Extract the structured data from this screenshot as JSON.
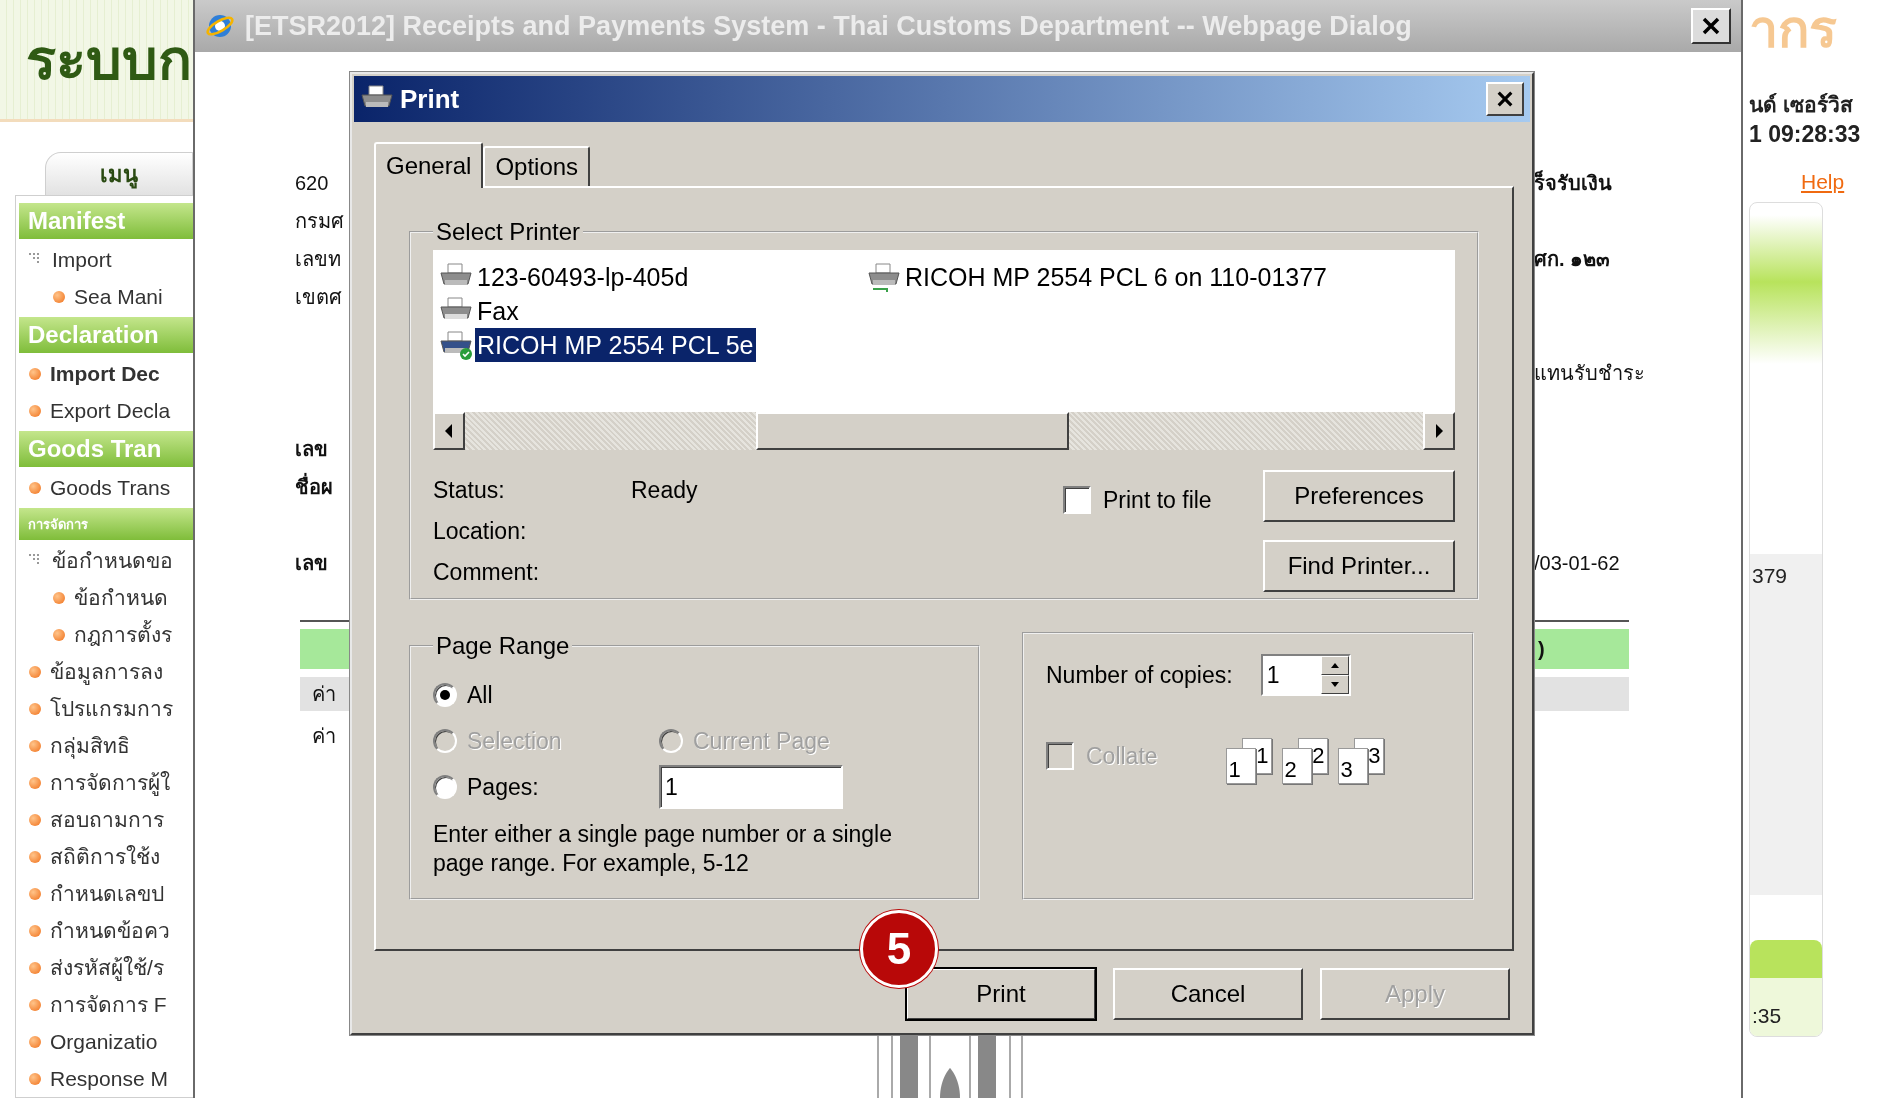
{
  "background_page": {
    "logo_text": "ระบบก",
    "menu_tab": "เมนู",
    "sidebar": [
      {
        "kind": "header",
        "label": "Manifest"
      },
      {
        "kind": "folder",
        "label": "Import",
        "children": [
          {
            "kind": "item",
            "label": "Sea Mani",
            "active": false
          }
        ]
      },
      {
        "kind": "header",
        "label": "Declaration"
      },
      {
        "kind": "item",
        "label": "Import Dec",
        "active": true
      },
      {
        "kind": "item",
        "label": "Export Decla",
        "active": false
      },
      {
        "kind": "header",
        "label": "Goods Tran"
      },
      {
        "kind": "item",
        "label": "Goods Trans",
        "active": false
      },
      {
        "kind": "subheader",
        "label": "การจัดการ"
      },
      {
        "kind": "folder",
        "label": "ข้อกำหนดขอ",
        "children": [
          {
            "kind": "item",
            "label": "ข้อกำหนด",
            "active": false
          },
          {
            "kind": "item",
            "label": "กฎการตั้งร",
            "active": false
          }
        ]
      },
      {
        "kind": "item",
        "label": "ข้อมูลการลง",
        "active": false
      },
      {
        "kind": "item",
        "label": "โปรแกรมการ",
        "active": false
      },
      {
        "kind": "item",
        "label": "กลุ่มสิทธิ",
        "active": false
      },
      {
        "kind": "item",
        "label": "การจัดการผู้ใ",
        "active": false
      },
      {
        "kind": "item",
        "label": "สอบถามการ",
        "active": false
      },
      {
        "kind": "item",
        "label": "สถิติการใช้ง",
        "active": false
      },
      {
        "kind": "item",
        "label": "กำหนดเลขป",
        "active": false
      },
      {
        "kind": "item",
        "label": "กำหนดข้อคว",
        "active": false
      },
      {
        "kind": "item",
        "label": "ส่งรหัสผู้ใช้/ร",
        "active": false
      },
      {
        "kind": "item",
        "label": "การจัดการ F",
        "active": false
      },
      {
        "kind": "item",
        "label": "Organizatio",
        "active": false
      },
      {
        "kind": "item",
        "label": "Response M",
        "active": false
      }
    ],
    "header_right": {
      "logo_text": "ากร",
      "user": "นด์ เซอร์วิส",
      "datetime": "1 09:28:33",
      "help": "Help"
    },
    "panel_values": [
      "379",
      ":35"
    ]
  },
  "webpage_dialog": {
    "title": "[ETSR2012] Receipts and Payments System - Thai Customs Department -- Webpage Dialog",
    "rows": [
      {
        "kind": "text",
        "left": {
          "text": "620",
          "bold": false
        },
        "right": {
          "text": "ร็จรับเงิน",
          "bold": true
        }
      },
      {
        "kind": "text",
        "left": {
          "text": "กรมศ",
          "bold": false
        }
      },
      {
        "kind": "text",
        "left": {
          "text": "เลขท",
          "bold": false
        },
        "right": {
          "text": "ศก. ๑๒๓",
          "bold": true
        }
      },
      {
        "kind": "text",
        "left": {
          "text": "เขตศ",
          "bold": false
        }
      },
      {
        "kind": "blank"
      },
      {
        "kind": "text",
        "right": {
          "text": "แทนรับชำระ",
          "bold": false
        }
      },
      {
        "kind": "blank"
      },
      {
        "kind": "text",
        "left": {
          "text": "เลข",
          "bold": true
        }
      },
      {
        "kind": "text",
        "left": {
          "text": "ชื่อผ",
          "bold": true
        }
      },
      {
        "kind": "blank"
      },
      {
        "kind": "text",
        "left": {
          "text": "เลข",
          "bold": true
        },
        "right": {
          "text": "/03-01-62",
          "bold": false
        }
      }
    ],
    "table": {
      "header_right": ")",
      "rows": [
        {
          "left": "ค่า",
          "shaded": true
        },
        {
          "left": "ค่า",
          "shaded": false
        }
      ]
    }
  },
  "print_dialog": {
    "title": "Print",
    "tabs": [
      {
        "label": "General",
        "selected": true
      },
      {
        "label": "Options",
        "selected": false
      }
    ],
    "select_printer": {
      "legend": "Select Printer",
      "printers": [
        {
          "name": "123-60493-lp-405d",
          "kind": "printer",
          "selected": false
        },
        {
          "name": "Fax",
          "kind": "fax",
          "selected": false
        },
        {
          "name": "RICOH MP 2554 PCL 5e",
          "kind": "default",
          "selected": true
        },
        {
          "name": "RICOH MP 2554 PCL 6 on 110-01377",
          "kind": "network",
          "selected": false
        }
      ],
      "status_label": "Status:",
      "status": "Ready",
      "location_label": "Location:",
      "comment_label": "Comment:",
      "print_to_file": {
        "label": "Print to file",
        "checked": false
      },
      "buttons": [
        "Preferences",
        "Find Printer..."
      ]
    },
    "page_range": {
      "legend": "Page Range",
      "options": [
        {
          "label": "All",
          "selected": true,
          "disabled": false
        },
        {
          "label": "Selection",
          "selected": false,
          "disabled": true
        },
        {
          "label": "Current Page",
          "selected": false,
          "disabled": true
        },
        {
          "label": "Pages:",
          "selected": false,
          "disabled": false
        }
      ],
      "pages_value": "1",
      "hint": "Enter either a single page number or a single page range.  For example, 5-12"
    },
    "copies": {
      "label": "Number of copies:",
      "value": "1",
      "collate": {
        "label": "Collate",
        "checked": false,
        "disabled": true
      },
      "collate_sets": [
        {
          "back": "1",
          "front": "1"
        },
        {
          "back": "2",
          "front": "2"
        },
        {
          "back": "3",
          "front": "3"
        }
      ]
    },
    "buttons": [
      {
        "label": "Print",
        "default": true,
        "disabled": false
      },
      {
        "label": "Cancel",
        "default": false,
        "disabled": false
      },
      {
        "label": "Apply",
        "default": false,
        "disabled": true
      }
    ],
    "step_badge": "5"
  }
}
